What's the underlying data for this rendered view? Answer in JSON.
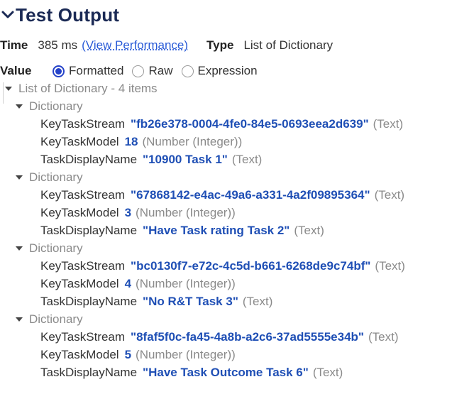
{
  "header": {
    "title": "Test Output",
    "collapse_icon": "chevron-down-icon"
  },
  "meta": {
    "time_label": "Time",
    "time_value": "385 ms",
    "performance_link": "(View Performance)",
    "type_label": "Type",
    "type_value": "List of Dictionary"
  },
  "value_mode": {
    "label": "Value",
    "options": [
      "Formatted",
      "Raw",
      "Expression"
    ],
    "selected": "Formatted"
  },
  "tree": {
    "root_label": "List of Dictionary - 4 items",
    "dictionary_label": "Dictionary",
    "items": [
      {
        "stream_key": "KeyTaskStream",
        "stream_value": "\"fb26e378-0004-4fe0-84e5-0693eea2d639\"",
        "stream_type": "(Text)",
        "model_key": "KeyTaskModel",
        "model_value": "18",
        "model_type": "(Number (Integer))",
        "name_key": "TaskDisplayName",
        "name_value": "\"10900 Task 1\"",
        "name_type": "(Text)"
      },
      {
        "stream_key": "KeyTaskStream",
        "stream_value": "\"67868142-e4ac-49a6-a331-4a2f09895364\"",
        "stream_type": "(Text)",
        "model_key": "KeyTaskModel",
        "model_value": "3",
        "model_type": "(Number (Integer))",
        "name_key": "TaskDisplayName",
        "name_value": "\"Have Task rating Task 2\"",
        "name_type": "(Text)"
      },
      {
        "stream_key": "KeyTaskStream",
        "stream_value": "\"bc0130f7-e72c-4c5d-b661-6268de9c74bf\"",
        "stream_type": "(Text)",
        "model_key": "KeyTaskModel",
        "model_value": "4",
        "model_type": "(Number (Integer))",
        "name_key": "TaskDisplayName",
        "name_value": "\"No R&T Task 3\"",
        "name_type": "(Text)"
      },
      {
        "stream_key": "KeyTaskStream",
        "stream_value": "\"8faf5f0c-fa45-4a8b-a2c6-37ad5555e34b\"",
        "stream_type": "(Text)",
        "model_key": "KeyTaskModel",
        "model_value": "5",
        "model_type": "(Number (Integer))",
        "name_key": "TaskDisplayName",
        "name_value": "\"Have Task Outcome Task 6\"",
        "name_type": "(Text)"
      }
    ]
  }
}
